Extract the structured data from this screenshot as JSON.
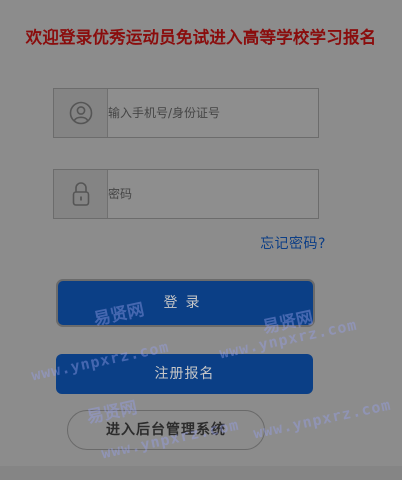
{
  "title": "欢迎登录优秀运动员免试进入高等学校学习报名",
  "login_form": {
    "phone_placeholder": "输入手机号/身份证号",
    "password_placeholder": "密码",
    "forgot_password": "忘记密码?"
  },
  "buttons": {
    "login": "登录",
    "register": "注册报名",
    "admin": "进入后台管理系统"
  },
  "icons": {
    "user": "user-circle-icon",
    "lock": "padlock-icon"
  },
  "watermark": {
    "site_name": "易贤网",
    "site_url": "www.ynpxrz.com"
  },
  "colors": {
    "title": "#8a0d0d",
    "primary_button": "#0b3f86",
    "link": "#0c3e86",
    "overlay": "#8c8c8c"
  }
}
